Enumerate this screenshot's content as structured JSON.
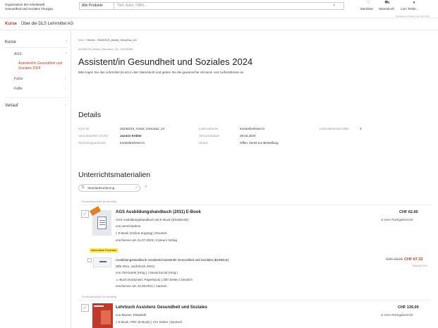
{
  "header": {
    "org_line1": "Organisation der Arbeitswelt",
    "org_line2": "Gesundheit und Soziales Thurgau",
    "product_select": "Alle Produkte",
    "search_placeholder": "Titel, Autor, ISBN...",
    "merkliste": "Merkliste",
    "warenkorb": "Warenkorb",
    "user": "Lars Testle...",
    "sub": "Kundenlevel: Default, ab CHF 10.00"
  },
  "nav": {
    "kurse": "Kurse",
    "about": "Über die DLS Lehrmittel AG"
  },
  "sidebar": {
    "kurse": "Kurse",
    "ags": "AGS",
    "active": "Assistent/in Gesundheit und Soziales 2024",
    "fage": "FaGe",
    "fabe": "FaBe",
    "verlauf": "Verlauf"
  },
  "breadcrumb": {
    "root": "Mein",
    "home": "Home",
    "sep": "›",
    "current": "20240219_Assist_GesuSoz_24"
  },
  "subid": "20240219_Assist_GesuSoz_24 › 22035398",
  "page_title": "Assistent/in Gesundheit und Soziales 2024",
  "intro": "Bitte legen Sie das Lehrmittel (Kurs) in den Warenkorb und geben Sie die gewünschte Versand- und Lieferadresse an.",
  "details": {
    "heading": "Details",
    "rows": [
      {
        "k1": "Kurs-ID",
        "v1": "20240219_Assist_GesuSoz_24",
        "k2": "Lieferadresse",
        "v2": "Kursteilnehmer:in",
        "k3": "Lehrmittelmaterialien",
        "v3": "3"
      },
      {
        "k1": "Verantwortlich (KVR)",
        "v1": "Jasmin Köbler",
        "k2": "Versanddatum",
        "v2": "29.02.2024",
        "k3": "",
        "v3": ""
      },
      {
        "k1": "Rechnungsadresse",
        "v1": "Kursteilnehmer:in",
        "k2": "Status",
        "v2": "Offen, bereit zur Bestellung",
        "k3": "",
        "v3": ""
      }
    ]
  },
  "materials": {
    "heading": "Unterrichtsmaterialien",
    "sort_label": "Standardsortierung",
    "required_note": "Produktauswahl ist freiwillig.",
    "alt_label": "Alternative Produkte",
    "products": [
      {
        "title": "AGS Ausbildungshandbuch (2011) E-Book",
        "line1": "AGS Ausbildungshandbuch als E-Book (EDUBASE)",
        "line2": "von verschiedene",
        "line3": "E-Book (Online-Zugang) | Deutsch",
        "line4": "erschienen am 21.07.2023 | Careum Verlag",
        "price": "CHF 62.00",
        "no_return": "Kein Rückgaberecht"
      },
      {
        "title": "Ausbildungshandbuch Assistent/Assistentin Gesundheit und Soziales (BUNDLE)",
        "line1": "(Bfe 2011, nachdruck 2021)",
        "line2": "von OdASanté (Hrsg.) | SavoirSocial (Hrsg.)",
        "line3": "Buch (Kartoniert, Paperback) | 200 Seiten | Deutsch",
        "line4": "erschienen am 19.08.2011 | Careum",
        "old_price": "CHF 68.95",
        "price": "CHF 67.33",
        "rabatt": "Rabatt 15%"
      },
      {
        "title": "Lehrbuch Assistenz Gesundheit und Soziales",
        "line1": "von Blunier, Elisabeth",
        "line2": "E-Book, PDF (E-Book) | 472 Seiten | Deutsch",
        "price": "CHF 135.00",
        "no_return": "Kein Rückgaberecht"
      }
    ]
  },
  "colors": {
    "accent": "#c0392b",
    "highlight": "#ffeb3b"
  }
}
